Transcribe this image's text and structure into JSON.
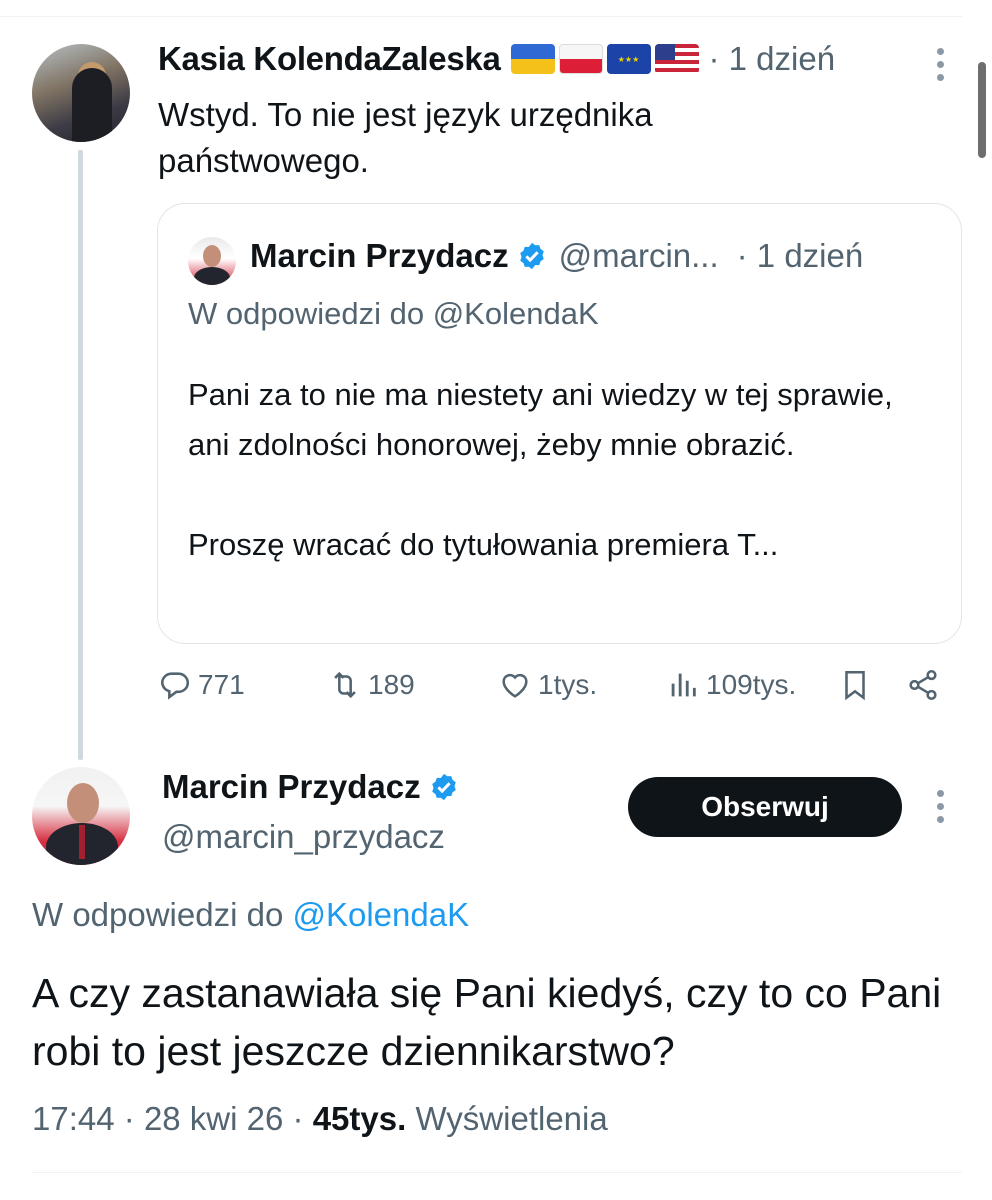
{
  "tweet1": {
    "author": "Kasia KolendaZaleska",
    "flags": [
      "ukraine-flag",
      "poland-flag",
      "eu-flag",
      "usa-flag"
    ],
    "time": "· 1 dzień",
    "text": "Wstyd. To nie jest język urzędnika państwowego."
  },
  "quote": {
    "author": "Marcin Przydacz",
    "handle": "@marcin...",
    "time": "· 1 dzień",
    "reply_prefix": "W odpowiedzi do",
    "reply_to": "@KolendaK",
    "text": "Pani za to nie ma niestety ani wiedzy w tej sprawie, ani zdolności honorowej, żeby mnie obrazić.\n\nProszę wracać do tytułowania premiera T..."
  },
  "actions": {
    "replies": "771",
    "reposts": "189",
    "likes": "1tys.",
    "views": "109tys."
  },
  "tweet2": {
    "author": "Marcin Przydacz",
    "handle": "@marcin_przydacz",
    "follow_label": "Obserwuj",
    "reply_prefix": "W odpowiedzi do",
    "reply_to": "@KolendaK",
    "text": "A czy zastanawiała się Pani kiedyś, czy to co Pani robi to jest jeszcze dziennikarstwo?",
    "time": "17:44",
    "date": "28 kwi 26",
    "views_count": "45tys.",
    "views_label": "Wyświetlenia"
  },
  "colors": {
    "accent": "#1d9bf0",
    "text": "#0f1419",
    "muted": "#536471",
    "button": "#0f1419"
  }
}
